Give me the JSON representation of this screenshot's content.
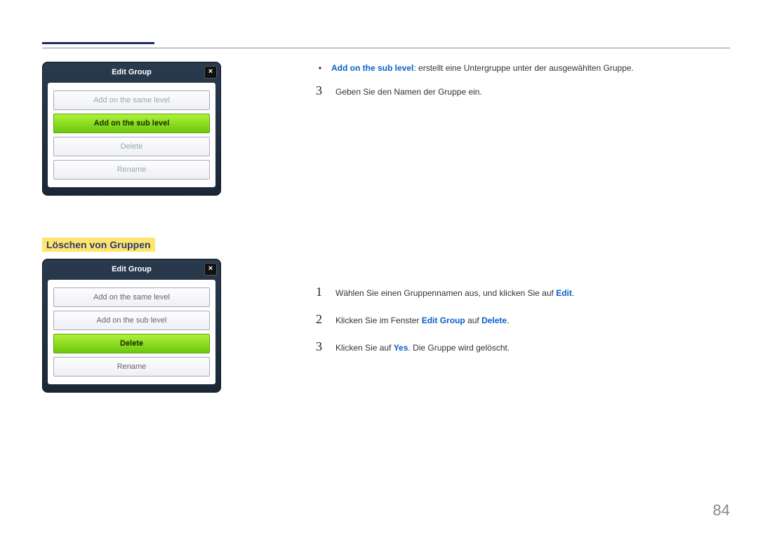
{
  "page_number": "84",
  "dialog1": {
    "title": "Edit Group",
    "close": "×",
    "options": [
      {
        "label": "Add on the same level",
        "state": "muted"
      },
      {
        "label": "Add on the sub level",
        "state": "selected"
      },
      {
        "label": "Delete",
        "state": "muted"
      },
      {
        "label": "Rename",
        "state": "muted"
      }
    ]
  },
  "section1": {
    "bullet": {
      "mark": "•",
      "kw": "Add on the sub level",
      "rest": ": erstellt eine Untergruppe unter der ausgewählten Gruppe."
    },
    "step": {
      "num": "3",
      "text": "Geben Sie den Namen der Gruppe ein."
    }
  },
  "section2": {
    "heading": "Löschen von Gruppen",
    "dialog": {
      "title": "Edit Group",
      "close": "×",
      "options": [
        {
          "label": "Add on the same level",
          "state": "normal"
        },
        {
          "label": "Add on the sub level",
          "state": "normal"
        },
        {
          "label": "Delete",
          "state": "selected"
        },
        {
          "label": "Rename",
          "state": "normal"
        }
      ]
    },
    "steps": [
      {
        "num": "1",
        "pre": "Wählen Sie einen Gruppennamen aus, und klicken Sie auf ",
        "kw1": "Edit",
        "post": "."
      },
      {
        "num": "2",
        "pre": "Klicken Sie im Fenster ",
        "kw1": "Edit Group",
        "mid": " auf ",
        "kw2": "Delete",
        "post": "."
      },
      {
        "num": "3",
        "pre": "Klicken Sie auf ",
        "kw1": "Yes",
        "post": ". Die Gruppe wird gelöscht."
      }
    ]
  }
}
